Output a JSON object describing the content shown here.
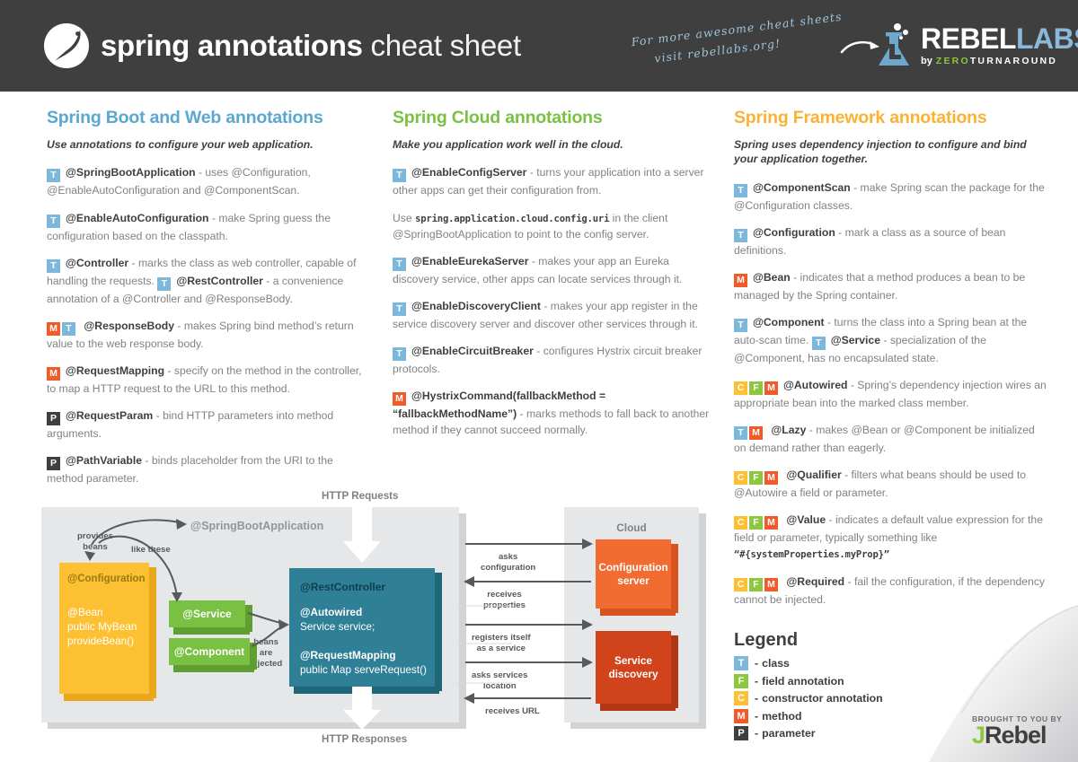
{
  "header": {
    "brand": "spring",
    "title_bold": "annotations",
    "title_light": "cheat sheet",
    "hand_note_line1": "For more awesome cheat sheets",
    "hand_note_line2": "visit rebellabs.org!",
    "rebel_main_1": "REBEL",
    "rebel_main_2": "LABS",
    "rebel_by": "by",
    "rebel_zero": "ZERO",
    "rebel_turnaround": "TURNAROUND",
    "bg_color": "#3f3f3f"
  },
  "columns": {
    "boot": {
      "title": "Spring Boot and Web annotations",
      "title_color": "#5ba7cf",
      "subtitle": "Use annotations to configure your web application.",
      "entries": [
        {
          "badges": [
            "T"
          ],
          "name": "@SpringBootApplication",
          "desc": " - uses @Configuration, @EnableAutoConfiguration and @ComponentScan."
        },
        {
          "badges": [
            "T"
          ],
          "name": "@EnableAutoConfiguration",
          "desc": " - make Spring guess the configuration based on the classpath."
        },
        {
          "badges": [
            "T"
          ],
          "name": "@Controller",
          "desc": " - marks the class as web controller, capable of handling the requests. ",
          "badges2": [
            "T"
          ],
          "name2": "@RestController",
          "desc2": " - a convenience annotation of a @Controller and @ResponseBody."
        },
        {
          "badges": [
            "M",
            "T"
          ],
          "name": "@ResponseBody",
          "desc": " - makes Spring bind method’s return value to the web response body."
        },
        {
          "badges": [
            "M"
          ],
          "name": "@RequestMapping",
          "desc": " - specify on the method in the controller, to map a HTTP request to the URL to this method."
        },
        {
          "badges": [
            "P"
          ],
          "name": "@RequestParam",
          "desc": " - bind HTTP parameters into method arguments."
        },
        {
          "badges": [
            "P"
          ],
          "name": "@PathVariable",
          "desc": " - binds placeholder from the URI to the method parameter."
        }
      ]
    },
    "cloud": {
      "title": "Spring Cloud annotations",
      "title_color": "#7ac143",
      "subtitle": "Make you application work well in the cloud.",
      "entries": [
        {
          "badges": [
            "T"
          ],
          "name": "@EnableConfigServer",
          "desc": " - turns your application into a server other apps can get their configuration from."
        },
        {
          "badges": [],
          "prefix": "Use ",
          "code": "spring.application.cloud.config.uri",
          "desc": " in the client @SpringBootApplication to point to the config server."
        },
        {
          "badges": [
            "T"
          ],
          "name": "@EnableEurekaServer",
          "desc": " - makes your app an Eureka discovery service, other apps can locate services through it."
        },
        {
          "badges": [
            "T"
          ],
          "name": "@EnableDiscoveryClient",
          "desc": " - makes your app register in the service discovery server and discover other services through it."
        },
        {
          "badges": [
            "T"
          ],
          "name": "@EnableCircuitBreaker",
          "desc": " - configures Hystrix circuit breaker protocols."
        },
        {
          "badges": [
            "M"
          ],
          "name": "@HystrixCommand(fallbackMethod = “fallbackMethodName”)",
          "desc": " - marks methods to fall back to another method if they cannot succeed normally."
        }
      ]
    },
    "framework": {
      "title": "Spring Framework annotations",
      "title_color": "#f9b233",
      "subtitle": "Spring uses dependency injection to configure and bind your application together.",
      "entries": [
        {
          "badges": [
            "T"
          ],
          "name": "@ComponentScan",
          "desc": " - make Spring scan the package for the @Configuration classes."
        },
        {
          "badges": [
            "T"
          ],
          "name": "@Configuration",
          "desc": " - mark a class as a source of bean definitions."
        },
        {
          "badges": [
            "M"
          ],
          "name": "@Bean",
          "desc": " - indicates that a method produces a bean to be managed by the Spring container."
        },
        {
          "badges": [
            "T"
          ],
          "name": "@Component",
          "desc": " - turns the class into a Spring bean at the auto-scan time. ",
          "badges2": [
            "T"
          ],
          "name2": "@Service",
          "desc2": " - specialization of the @Component, has no encapsulated state."
        },
        {
          "badges": [
            "C",
            "F",
            "M"
          ],
          "name": "@Autowired",
          "desc": " - Spring’s dependency injection wires an appropriate bean into the marked class member."
        },
        {
          "badges": [
            "T",
            "M"
          ],
          "name": "@Lazy",
          "desc": " - makes @Bean or @Component be initialized on demand rather than eagerly."
        },
        {
          "badges": [
            "C",
            "F",
            "M"
          ],
          "name": "@Qualifier",
          "desc": " - filters what beans should be used to @Autowire a field or parameter."
        },
        {
          "badges": [
            "C",
            "F",
            "M"
          ],
          "name": "@Value",
          "desc": " - indicates a default value expression for the field or parameter, typically something like ",
          "code_after": "“#{systemProperties.myProp}”"
        },
        {
          "badges": [
            "C",
            "F",
            "M"
          ],
          "name": "@Required",
          "desc": " - fail the configuration, if the dependency cannot be injected."
        }
      ]
    }
  },
  "legend": {
    "title": "Legend",
    "items": [
      {
        "badge": "T",
        "dash": "-",
        "label": " class",
        "color": "#7cb8dc"
      },
      {
        "badge": "F",
        "dash": "-",
        "label": " field annotation",
        "color": "#8dc63f"
      },
      {
        "badge": "C",
        "dash": "-",
        "label": "constructor annotation",
        "color": "#fcc032"
      },
      {
        "badge": "M",
        "dash": "-",
        "label": "method",
        "color": "#f15a29"
      },
      {
        "badge": "P",
        "dash": "-",
        "label": "parameter",
        "color": "#3f3f3f"
      }
    ]
  },
  "diagram": {
    "http_requests": "HTTP Requests",
    "http_responses": "HTTP Responses",
    "cloud_title": "Cloud",
    "springbootapplication": "@SpringBootApplication",
    "provides_beans": "provides\nbeans",
    "like_these": "like these",
    "beans_injected": "beans\nare\ninjected",
    "config_header": "@Configuration",
    "config_body": "@Bean\npublic MyBean\nprovideBean()",
    "service": "@Service",
    "component": "@Component",
    "rest_header": "@RestController",
    "rest_line1": "@Autowired",
    "rest_line2": "Service service;",
    "rest_line3": "@RequestMapping",
    "rest_line4": "public Map serveRequest()",
    "configuration_server": "Configuration\nserver",
    "service_discovery": "Service\ndiscovery",
    "asks_configuration": "asks\nconfiguration",
    "receives_properties": "receives\nproperties",
    "registers_itself": "registers itself\nas a service",
    "asks_services_location": "asks services\nlocation",
    "receives_url": "receives URL"
  },
  "footer": {
    "brought_to_you_by": "BROUGHT TO YOU BY",
    "jrebel_j": "J",
    "jrebel_rest": "Rebel"
  }
}
